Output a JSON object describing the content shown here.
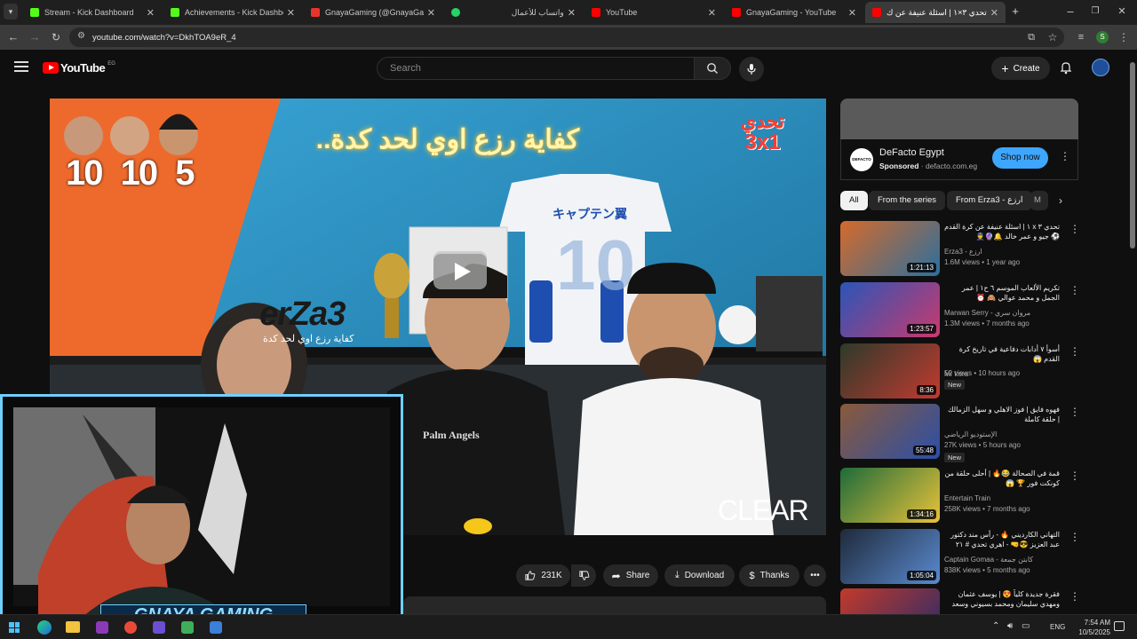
{
  "browser": {
    "tabs": [
      {
        "title": "Stream - Kick Dashboard",
        "color": "#53fc18"
      },
      {
        "title": "Achievements - Kick Dashboard",
        "color": "#53fc18"
      },
      {
        "title": "GnayaGaming (@GnayaGaming",
        "color": "#e8352b"
      },
      {
        "title": "واتساب للأعمال",
        "color": "#25d366"
      },
      {
        "title": "YouTube",
        "color": "#ff0000"
      },
      {
        "title": "GnayaGaming - YouTube",
        "color": "#ff0000"
      },
      {
        "title": "تحدي ٣×١ | اسئلة عنيفة عن ك",
        "color": "#ff0000"
      }
    ],
    "url": "youtube.com/watch?v=DkhTOA9eR_4",
    "profile_letter": "S"
  },
  "youtube": {
    "logo_text": "YouTube",
    "country": "EG",
    "search_placeholder": "Search",
    "create_label": "Create"
  },
  "video": {
    "challenge_label": "تحدي",
    "challenge_format": "3x1",
    "scores": [
      "10",
      "10",
      "5"
    ],
    "caption_arabic": "كفاية رزع اوي لحد كدة..",
    "brand_sign": "erZa3",
    "sub_sign": "كفاية رزع اوي لحد كدة",
    "jersey_text": "キャプテン翼",
    "jersey_number": "10",
    "watermark": "CLEAR",
    "shirt_brand": "Palm Angels"
  },
  "overlay": {
    "streamer_name": "GNAYA GAMING"
  },
  "actions": {
    "likes": "231K",
    "share": "Share",
    "download": "Download",
    "thanks": "Thanks"
  },
  "ad": {
    "brand": "DeFacto Egypt",
    "sponsored": "Sponsored",
    "domain": "defacto.com.eg",
    "cta": "Shop now",
    "logo_text": "DEFACTO"
  },
  "chips": [
    "All",
    "From the series",
    "From Erza3 - ارزع",
    "M"
  ],
  "sidebar": [
    {
      "title": "تحدي ٣ x ١ | اسئلة عنيفة عن كرة القدم ⚽ جيو و عمر خالد 🔔🔮👮",
      "channel": "Erza3 - ارزع",
      "meta": "1.6M views • 1 year ago",
      "duration": "1:21:13",
      "new": ""
    },
    {
      "title": "تكريم الألعاب الموسم ٦ ح١ | عمر الجمل و محمد عوالي 🙈 ⏰",
      "channel": "Marwan Serry - مروان سري",
      "meta": "1.3M views • 7 months ago",
      "duration": "1:23:57",
      "new": ""
    },
    {
      "title": "أسوأ ٧ أدابات دفاعية في تاريخ كرة القدم 😱",
      "channel": "Mr kora",
      "meta": "52 views • 10 hours ago",
      "duration": "8:36",
      "new": "New"
    },
    {
      "title": "فهوه فايق | فوز الاهلي و سهل الزمالك | حلقة كاملة",
      "channel": "الإستوديو الرياضي",
      "meta": "27K views • 5 hours ago",
      "duration": "55:48",
      "new": "New"
    },
    {
      "title": "قمة في الصحالة 😂🔥 | أحلى حلقة من كونكت فور 🏆 😱",
      "channel": "Entertain Train",
      "meta": "258K views • 7 months ago",
      "duration": "1:34:16",
      "new": ""
    },
    {
      "title": "التهاني الكارديني 🔥 - رأس مند دكتور عبد العزيز 😎🤜 - اهري تحدي # ٢١",
      "channel": "Captain Gomaa - كابتن جمعة",
      "meta": "838K views • 5 months ago",
      "duration": "1:05:04",
      "new": ""
    },
    {
      "title": "فقرة جديدة كلياً 😍 | يوسف عثمان ومهدي سليمان ومحمد بسيوني وسعد نصر",
      "channel": "",
      "meta": "",
      "duration": "",
      "new": ""
    }
  ],
  "taskbar": {
    "time": "7:54 AM",
    "date": "10/5/2025",
    "lang": "ENG"
  }
}
